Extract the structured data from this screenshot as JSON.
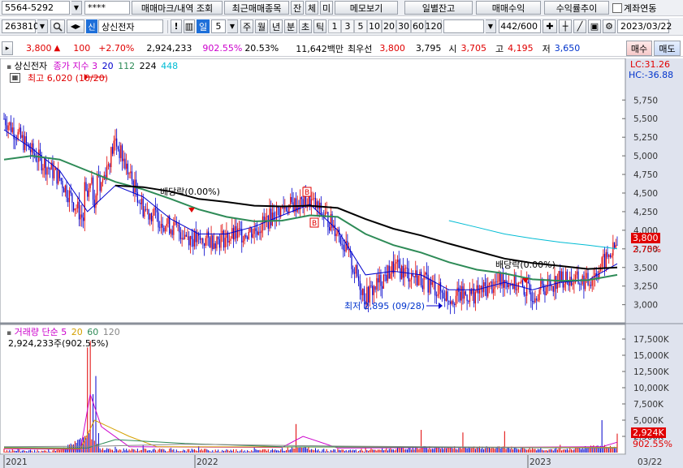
{
  "toolbar1": {
    "account": "5564-5292",
    "password_mask": "****",
    "tab_trades": "매매마크/내역 조회",
    "tab_recent": "최근매매종목",
    "btn_balance": "잔",
    "btn_execution": "체",
    "btn_unfilled": "미",
    "btn_memo": "메모보기",
    "btn_daily_balance": "일별잔고",
    "btn_profit": "매매수익",
    "btn_profit_trend": "수익률추이",
    "chk_account_link": "계좌연동"
  },
  "toolbar2": {
    "code": "263810",
    "market_badge": "신",
    "stock_name": "상신전자",
    "period_day": "일",
    "period_value": "5",
    "period_week": "주",
    "period_month": "월",
    "period_year": "년",
    "period_minute": "분",
    "period_second": "초",
    "period_tick": "틱",
    "intervals": [
      "1",
      "3",
      "5",
      "10",
      "20",
      "30",
      "60",
      "120"
    ],
    "count": "442",
    "count_total": "/600",
    "date": "2023/03/22"
  },
  "quote": {
    "price": "3,800",
    "up_arrow": "▲",
    "change": "100",
    "change_pct": "+2.70%",
    "volume": "2,924,233",
    "volume_ratio": "902.55%",
    "turnover": "20.53%",
    "amount": "11,642백만",
    "best_label": "최우선",
    "best_ask": "3,800",
    "best_bid": "3,795",
    "open_label": "시",
    "open": "3,705",
    "high_label": "고",
    "high": "4,195",
    "low_label": "저",
    "low": "3,650",
    "buy_button": "매수",
    "sell_button": "매도"
  },
  "legend": {
    "title": "상신전자",
    "ma_label": "종가 지수 3",
    "ma20": "20",
    "ma112": "112",
    "ma224": "224",
    "ma448": "448",
    "lc": "LC:31.26",
    "hc": "HC:-36.88",
    "vol_title": "거래량 단순 5",
    "vol20": "20",
    "vol60": "60",
    "vol120": "120",
    "vol_value": "2,924,233주(902.55%)"
  },
  "annotations": {
    "high_note": "최고 6,020 (10/20)",
    "low_note": "최저 2,895 (09/28)",
    "div1": "배당락(0.00%)",
    "div2": "배당락(0.00%)",
    "b_mark": "B"
  },
  "price_tags": {
    "price": "3,800",
    "pct": "2.70%",
    "vol": "2,924K",
    "vol_pct": "902.55%"
  },
  "colors": {
    "up": "#e00000",
    "down": "#0000cc",
    "ma3": "#0000ff",
    "ma20": "#0000cc",
    "ma112": "#2e8b57",
    "ma224": "#000000",
    "ma448": "#00bcd4",
    "axis_bg": "#dfe3ee"
  },
  "chart_data": [
    {
      "type": "line",
      "title": "상신전자",
      "x_ticks": [
        "2021",
        "2022",
        "2023",
        "03/22"
      ],
      "ylim": [
        2800,
        6200
      ],
      "y_ticks": [
        3000,
        3250,
        3500,
        3750,
        4000,
        4250,
        4500,
        4750,
        5000,
        5250,
        5500,
        5750
      ],
      "y_tick_labels": [
        "3,000",
        "3,250",
        "3,500",
        "3,750",
        "4,000",
        "4,250",
        "4,500",
        "4,750",
        "5,000",
        "5,250",
        "5,500",
        "5,750"
      ],
      "x_index": [
        0,
        20,
        40,
        60,
        80,
        100,
        120,
        140,
        160,
        180,
        200,
        220,
        240,
        260,
        280,
        300,
        320,
        340,
        360,
        380,
        400,
        420,
        441
      ],
      "series": [
        {
          "name": "종가",
          "values": [
            5500,
            5050,
            4700,
            4050,
            5200,
            4300,
            4050,
            3850,
            3900,
            4000,
            4300,
            4400,
            4000,
            3100,
            3500,
            3350,
            3100,
            3150,
            3350,
            3150,
            3350,
            3300,
            3800
          ]
        },
        {
          "name": "20",
          "values": [
            5350,
            5100,
            4800,
            4250,
            4600,
            4450,
            4150,
            3950,
            3950,
            4050,
            4200,
            4350,
            4000,
            3400,
            3450,
            3400,
            3200,
            3200,
            3300,
            3200,
            3300,
            3330,
            3550
          ]
        },
        {
          "name": "112",
          "values": [
            4950,
            5000,
            4950,
            4800,
            4650,
            4550,
            4420,
            4280,
            4180,
            4120,
            4130,
            4200,
            4180,
            3950,
            3800,
            3700,
            3570,
            3470,
            3420,
            3340,
            3320,
            3330,
            3400
          ]
        },
        {
          "name": "224",
          "values": [
            null,
            null,
            null,
            null,
            4600,
            4580,
            4520,
            4420,
            4380,
            4330,
            4320,
            4330,
            4300,
            4150,
            4020,
            3930,
            3820,
            3720,
            3620,
            3560,
            3520,
            3480,
            3500
          ]
        },
        {
          "name": "448",
          "values": [
            null,
            null,
            null,
            null,
            null,
            null,
            null,
            null,
            null,
            null,
            null,
            null,
            null,
            null,
            null,
            null,
            4130,
            4040,
            3950,
            3890,
            3840,
            3800,
            3750
          ]
        }
      ],
      "annotations": [
        {
          "label": "최고 6,020 (10/20)",
          "x": 60,
          "y": 6020
        },
        {
          "label": "최저 2,895 (09/28)",
          "x": 260,
          "y": 2895
        }
      ]
    },
    {
      "type": "bar",
      "title": "거래량",
      "ylim": [
        0,
        18500
      ],
      "y_ticks": [
        2500,
        5000,
        7500,
        10000,
        12500,
        15000,
        17500
      ],
      "y_tick_labels": [
        "2,500K",
        "5,000K",
        "7,500K",
        "10,000K",
        "12,500K",
        "15,000K",
        "17,500K"
      ],
      "x_index": [
        0,
        20,
        40,
        60,
        62,
        64,
        66,
        68,
        80,
        100,
        120,
        140,
        160,
        180,
        200,
        210,
        230,
        260,
        300,
        330,
        360,
        400,
        430,
        441
      ],
      "values": [
        600,
        300,
        400,
        16200,
        17200,
        9000,
        11800,
        3000,
        900,
        1200,
        700,
        1000,
        500,
        800,
        700,
        4400,
        600,
        700,
        3500,
        3100,
        3300,
        1200,
        5000,
        2924
      ]
    }
  ]
}
